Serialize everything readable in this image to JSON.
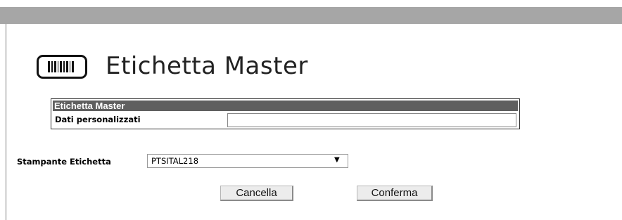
{
  "page": {
    "title": "Etichetta Master"
  },
  "panel": {
    "header": "Etichetta Master",
    "field_label": "Dati personalizzati",
    "field_value": ""
  },
  "printer": {
    "label": "Stampante Etichetta",
    "selected": "PTSITAL218",
    "arrow": "▼"
  },
  "actions": {
    "cancel_label": "Cancella",
    "confirm_label": "Conferma"
  },
  "icons": {
    "title_icon": "barcode-label-icon"
  },
  "colors": {
    "topbar": "#a6a6a6",
    "panel_header": "#5f5f5f"
  }
}
